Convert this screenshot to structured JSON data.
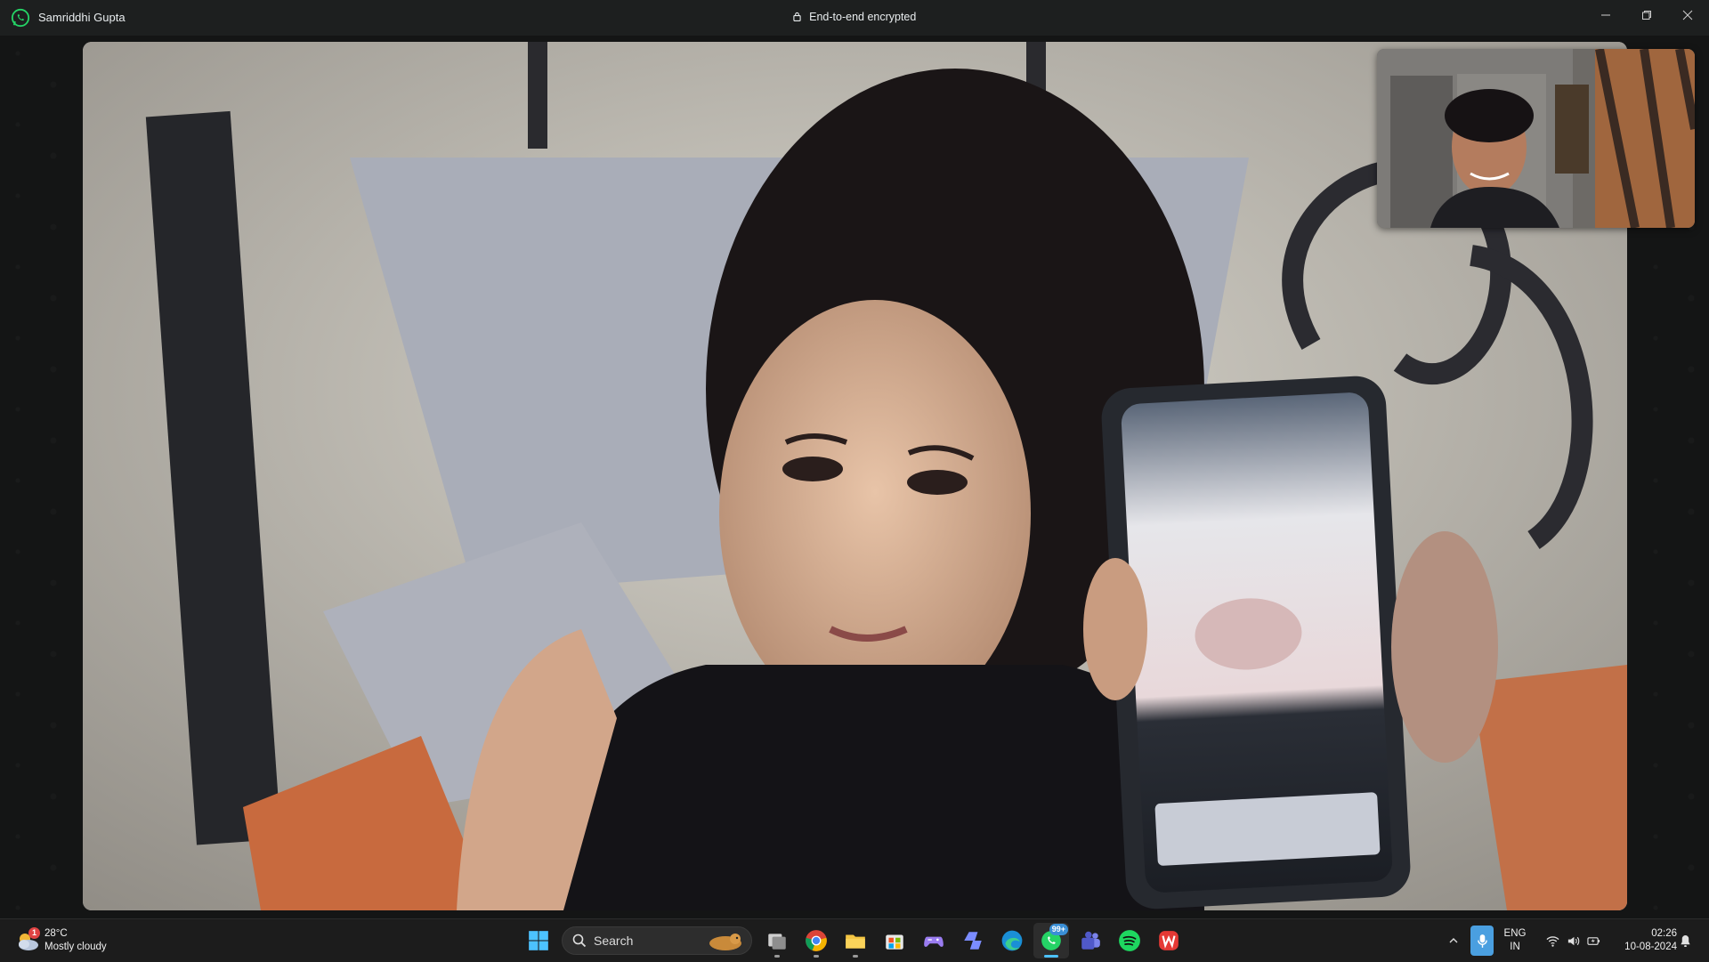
{
  "window": {
    "caller_name": "Samriddhi Gupta",
    "encryption_status": "End-to-end encrypted",
    "app_icon": "whatsapp-icon",
    "controls": [
      "minimize-icon",
      "restore-icon",
      "close-icon"
    ]
  },
  "call": {
    "remote_video": "remote-participant-video",
    "self_video": "self-view-video"
  },
  "taskbar": {
    "weather": {
      "temperature": "28°C",
      "condition": "Mostly cloudy",
      "badge": "1"
    },
    "search": {
      "label": "Search"
    },
    "apps": [
      {
        "name": "start",
        "icon": "windows-start-icon"
      },
      {
        "name": "task-view",
        "icon": "task-view-icon"
      },
      {
        "name": "chrome",
        "icon": "chrome-icon"
      },
      {
        "name": "file-explorer",
        "icon": "folder-icon"
      },
      {
        "name": "microsoft-store",
        "icon": "store-icon"
      },
      {
        "name": "xbox",
        "icon": "game-controller-icon"
      },
      {
        "name": "copilot",
        "icon": "copilot-icon"
      },
      {
        "name": "edge",
        "icon": "edge-icon"
      },
      {
        "name": "whatsapp",
        "icon": "whatsapp-icon",
        "badge": "99+",
        "active": true
      },
      {
        "name": "teams",
        "icon": "teams-icon"
      },
      {
        "name": "spotify",
        "icon": "spotify-icon"
      },
      {
        "name": "wps-office",
        "icon": "wps-icon"
      }
    ],
    "tray": {
      "language_top": "ENG",
      "language_bottom": "IN",
      "time": "02:26",
      "date": "10-08-2024"
    }
  },
  "colors": {
    "titlebar_bg": "#1d1f1f",
    "taskbar_bg": "#1c1c1c",
    "whatsapp_green": "#25d366",
    "accent_blue": "#4cc2ff"
  }
}
